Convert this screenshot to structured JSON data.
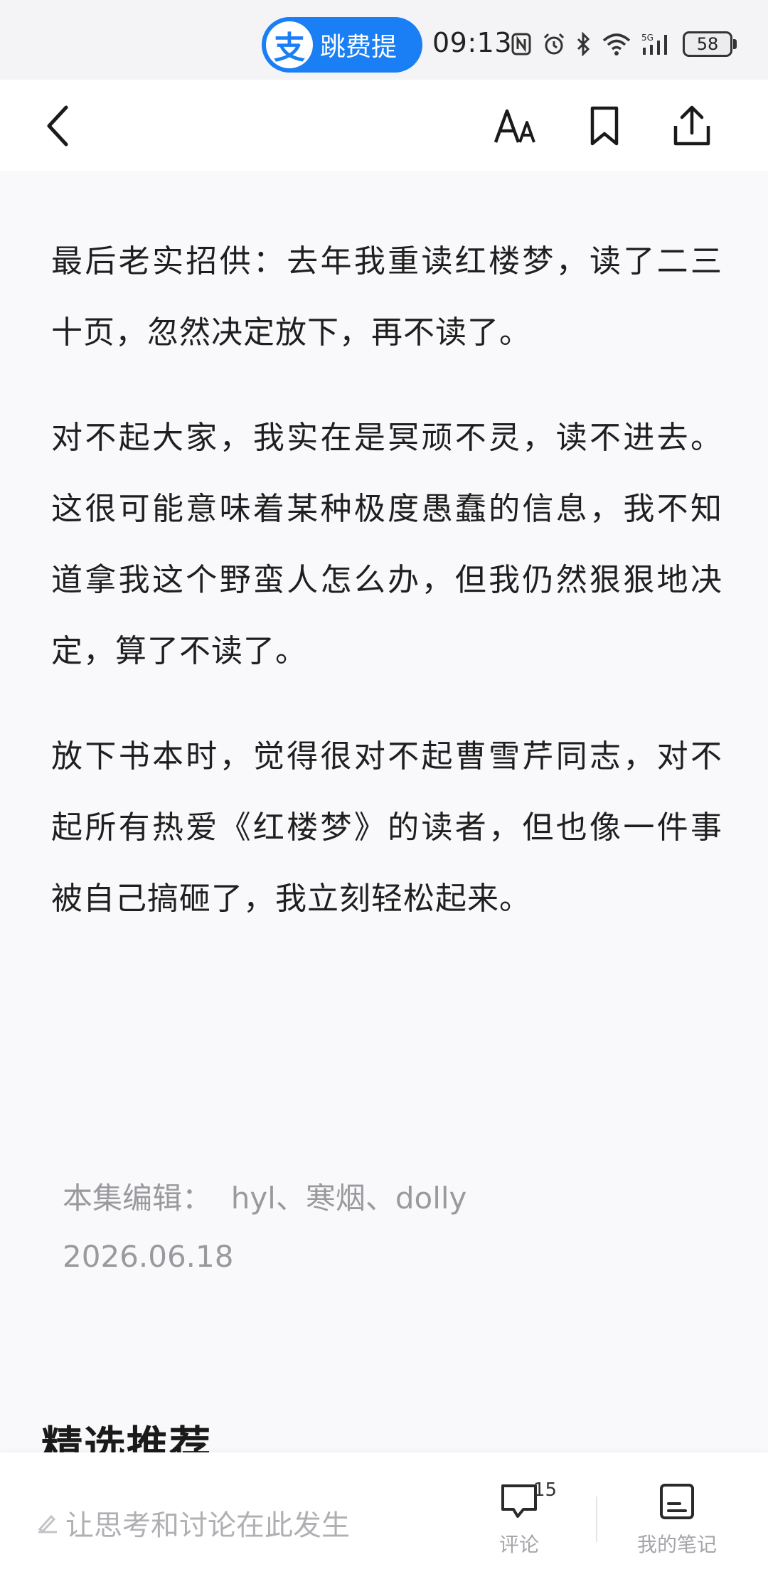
{
  "status_bar": {
    "pay_logo": "支",
    "pay_text": "跳费提",
    "time": "09:13",
    "icons": [
      "nfc-icon",
      "alarm-icon",
      "bluetooth-icon",
      "wifi-icon",
      "signal-5g-icon"
    ],
    "battery": "58"
  },
  "nav": {
    "back_icon": "chevron-left-icon",
    "font_icon": "font-size-icon",
    "bookmark_icon": "bookmark-icon",
    "share_icon": "share-icon"
  },
  "article": {
    "paragraphs": [
      "最后老实招供：去年我重读红楼梦，读了二三十页，忽然决定放下，再不读了。",
      "对不起大家，我实在是冥顽不灵，读不进去。这很可能意味着某种极度愚蠢的信息，我不知道拿我这个野蛮人怎么办，但我仍然狠狠地决定，算了不读了。",
      "放下书本时，觉得很对不起曹雪芹同志，对不起所有热爱《红楼梦》的读者，但也像一件事被自己搞砸了，我立刻轻松起来。"
    ],
    "editor": "本集编辑：  hyl、寒烟、dolly",
    "date": "2026.06.18"
  },
  "section_title": "精选推荐",
  "bottom_bar": {
    "comment_placeholder": "让思考和讨论在此发生",
    "comment_label": "评论",
    "comment_count": "15",
    "notes_label": "我的笔记"
  },
  "colors": {
    "accent_blue": "#1a7ef5",
    "background": "#f9f9fb",
    "text": "#1f1f1f",
    "muted": "#9a9a9e"
  }
}
